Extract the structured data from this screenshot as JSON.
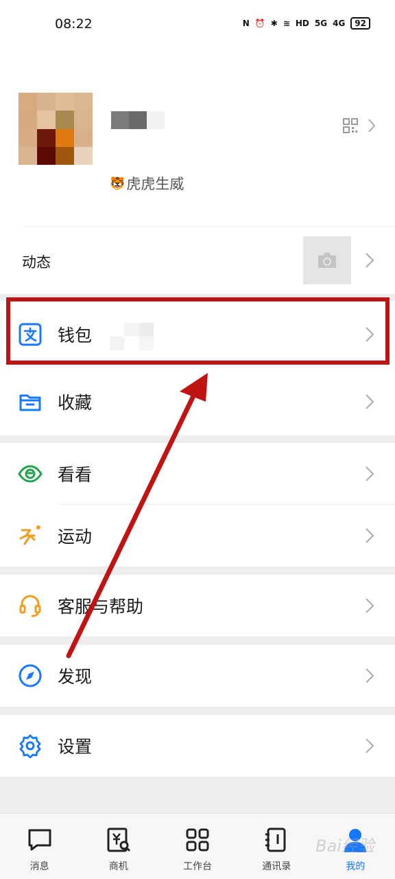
{
  "status_bar": {
    "time": "08:22",
    "network_1": "HD",
    "network_2": "5G",
    "network_3": "4G",
    "battery": "92"
  },
  "profile": {
    "status_text": "虎虎生威",
    "status_emoji": "tiger-emoji"
  },
  "moments": {
    "label": "动态"
  },
  "menu": {
    "wallet": "钱包",
    "favorites": "收藏",
    "watch": "看看",
    "sports": "运动",
    "support": "客服与帮助",
    "discover": "发现",
    "settings": "设置"
  },
  "tabs": [
    {
      "label": "消息"
    },
    {
      "label": "商机"
    },
    {
      "label": "工作台"
    },
    {
      "label": "通讯录"
    },
    {
      "label": "我的"
    }
  ],
  "colors": {
    "accent": "#1677ff",
    "highlight": "#c01414",
    "watch_icon": "#1fa34b",
    "sports_icon": "#f29c1f",
    "support_icon": "#f29c1f"
  },
  "watermark": "Bai经验"
}
